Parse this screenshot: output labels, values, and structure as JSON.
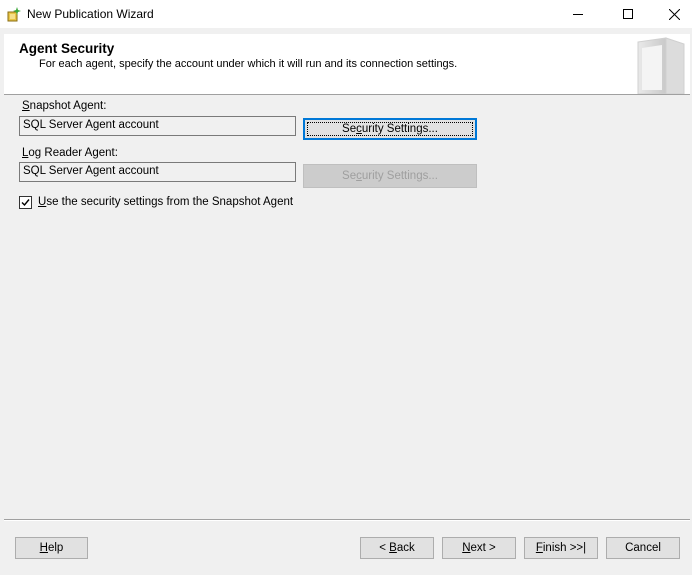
{
  "window": {
    "title": "New Publication Wizard"
  },
  "header": {
    "title": "Agent Security",
    "subtitle": "For each agent, specify the account under which it will run and its connection settings."
  },
  "snapshot_agent": {
    "label_mnemonic": "S",
    "label_rest": "napshot Agent:",
    "value": "SQL Server Agent account",
    "button_pre": "Se",
    "button_mnemonic": "c",
    "button_post": "urity Settings..."
  },
  "log_reader_agent": {
    "label_mnemonic": "L",
    "label_rest": "og Reader Agent:",
    "value": "SQL Server Agent account",
    "button_pre": "Se",
    "button_mnemonic": "c",
    "button_post": "urity Settings..."
  },
  "use_snapshot_settings": {
    "checked": true,
    "label_mnemonic": "U",
    "label_rest": "se the security settings from the Snapshot Agent"
  },
  "footer": {
    "help_mnemonic": "H",
    "help_rest": "elp",
    "back_pre": "< ",
    "back_mnemonic": "B",
    "back_rest": "ack",
    "next_mnemonic": "N",
    "next_rest": "ext >",
    "finish_mnemonic": "F",
    "finish_rest": "inish >>|",
    "cancel_label": "Cancel"
  },
  "colors": {
    "focus_border": "#0078d7",
    "window_bg": "#f0f0f0",
    "header_bg": "#ffffff"
  }
}
